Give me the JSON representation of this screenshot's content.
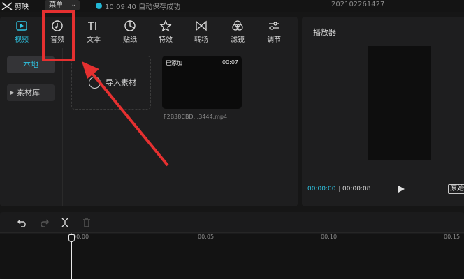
{
  "titlebar": {
    "app_name": "剪映",
    "menu_label": "菜单",
    "autosave_text": "10:09:40 自动保存成功",
    "project_name": "202102261427"
  },
  "tabs": [
    {
      "label": "视频",
      "icon": "video-icon",
      "active": true
    },
    {
      "label": "音频",
      "icon": "audio-icon",
      "active": false
    },
    {
      "label": "文本",
      "icon": "text-icon",
      "active": false
    },
    {
      "label": "贴纸",
      "icon": "sticker-icon",
      "active": false
    },
    {
      "label": "特效",
      "icon": "effects-icon",
      "active": false
    },
    {
      "label": "转场",
      "icon": "transition-icon",
      "active": false
    },
    {
      "label": "滤镜",
      "icon": "filter-icon",
      "active": false
    },
    {
      "label": "调节",
      "icon": "adjust-icon",
      "active": false
    }
  ],
  "sidebar": {
    "local": "本地",
    "library": "素材库"
  },
  "media": {
    "import_label": "导入素材",
    "clip": {
      "badge": "已添加",
      "duration": "00:07",
      "filename": "F2B38CBD...3444.mp4"
    }
  },
  "player": {
    "title": "播放器",
    "time_current": "00:00:00",
    "time_separator": "|",
    "time_total": "00:00:08",
    "ratio_label": "原始"
  },
  "timeline": {
    "ruler": [
      "00:00",
      "00:05",
      "00:10",
      "00:15"
    ]
  },
  "colors": {
    "accent": "#2fc4e2",
    "annotation": "#e53030",
    "panel": "#1e1e1f",
    "background": "#161616"
  }
}
